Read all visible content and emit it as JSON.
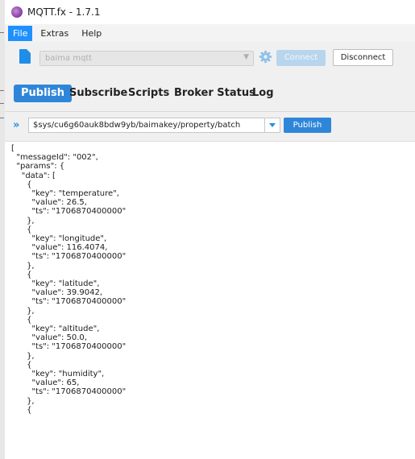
{
  "window": {
    "title": "MQTT.fx - 1.7.1"
  },
  "menubar": {
    "items": [
      "File",
      "Extras",
      "Help"
    ]
  },
  "connection": {
    "profile": "baima mqtt",
    "connect_label": "Connect",
    "disconnect_label": "Disconnect"
  },
  "tabs": [
    "Publish",
    "Subscribe",
    "Scripts",
    "Broker Status",
    "Log"
  ],
  "publish": {
    "topic": "$sys/cu6g60auk8bdw9yb/baimakey/property/batch",
    "publish_label": "Publish"
  },
  "editor": {
    "lines": [
      "[",
      "  \"messageId\": \"002\",",
      "  \"params\": {",
      "    \"data\": [",
      "      {",
      "        \"key\": \"temperature\",",
      "        \"value\": 26.5,",
      "        \"ts\": \"1706870400000\"",
      "      },",
      "      {",
      "        \"key\": \"longitude\",",
      "        \"value\": 116.4074,",
      "        \"ts\": \"1706870400000\"",
      "      },",
      "      {",
      "        \"key\": \"latitude\",",
      "        \"value\": 39.9042,",
      "        \"ts\": \"1706870400000\"",
      "      },",
      "      {",
      "        \"key\": \"altitude\",",
      "        \"value\": 50.0,",
      "        \"ts\": \"1706870400000\"",
      "      },",
      "      {",
      "        \"key\": \"humidity\",",
      "        \"value\": 65,",
      "        \"ts\": \"1706870400000\"",
      "      },",
      "      {"
    ]
  },
  "colors": {
    "accent": "#2f86d9",
    "menu_active": "#1e90ff"
  }
}
